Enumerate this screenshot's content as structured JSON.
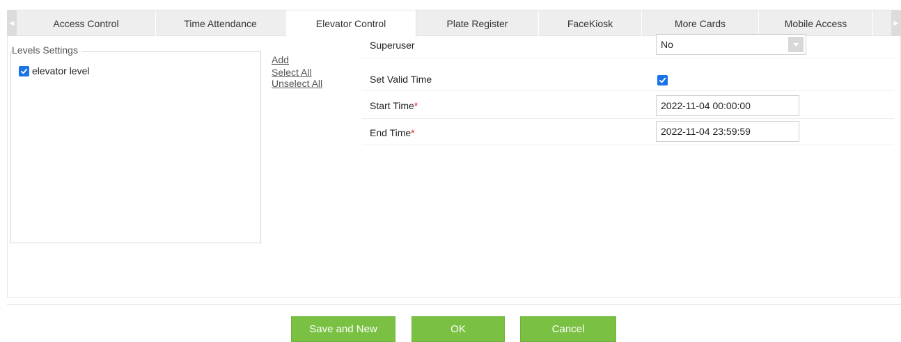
{
  "tabs": [
    {
      "label": "Access Control"
    },
    {
      "label": "Time Attendance"
    },
    {
      "label": "Elevator Control"
    },
    {
      "label": "Plate Register"
    },
    {
      "label": "FaceKiosk"
    },
    {
      "label": "More Cards"
    },
    {
      "label": "Mobile Access"
    }
  ],
  "active_tab": "Elevator Control",
  "levels": {
    "legend": "Levels Settings",
    "items": [
      {
        "label": "elevator level",
        "checked": true
      }
    ]
  },
  "links": {
    "add": "Add",
    "select_all": "Select All",
    "unselect_all": "Unselect All"
  },
  "form": {
    "superuser_label": "Superuser",
    "superuser_value": "No",
    "valid_time_label": "Set Valid Time",
    "valid_time_checked": true,
    "start_label": "Start Time",
    "start_value": "2022-11-04 00:00:00",
    "end_label": "End Time",
    "end_value": "2022-11-04 23:59:59",
    "required_mark": "*"
  },
  "buttons": {
    "save_new": "Save and New",
    "ok": "OK",
    "cancel": "Cancel"
  },
  "colors": {
    "accent_green": "#7ac143",
    "checkbox_blue": "#1a73e8",
    "required_red": "#e02020"
  }
}
